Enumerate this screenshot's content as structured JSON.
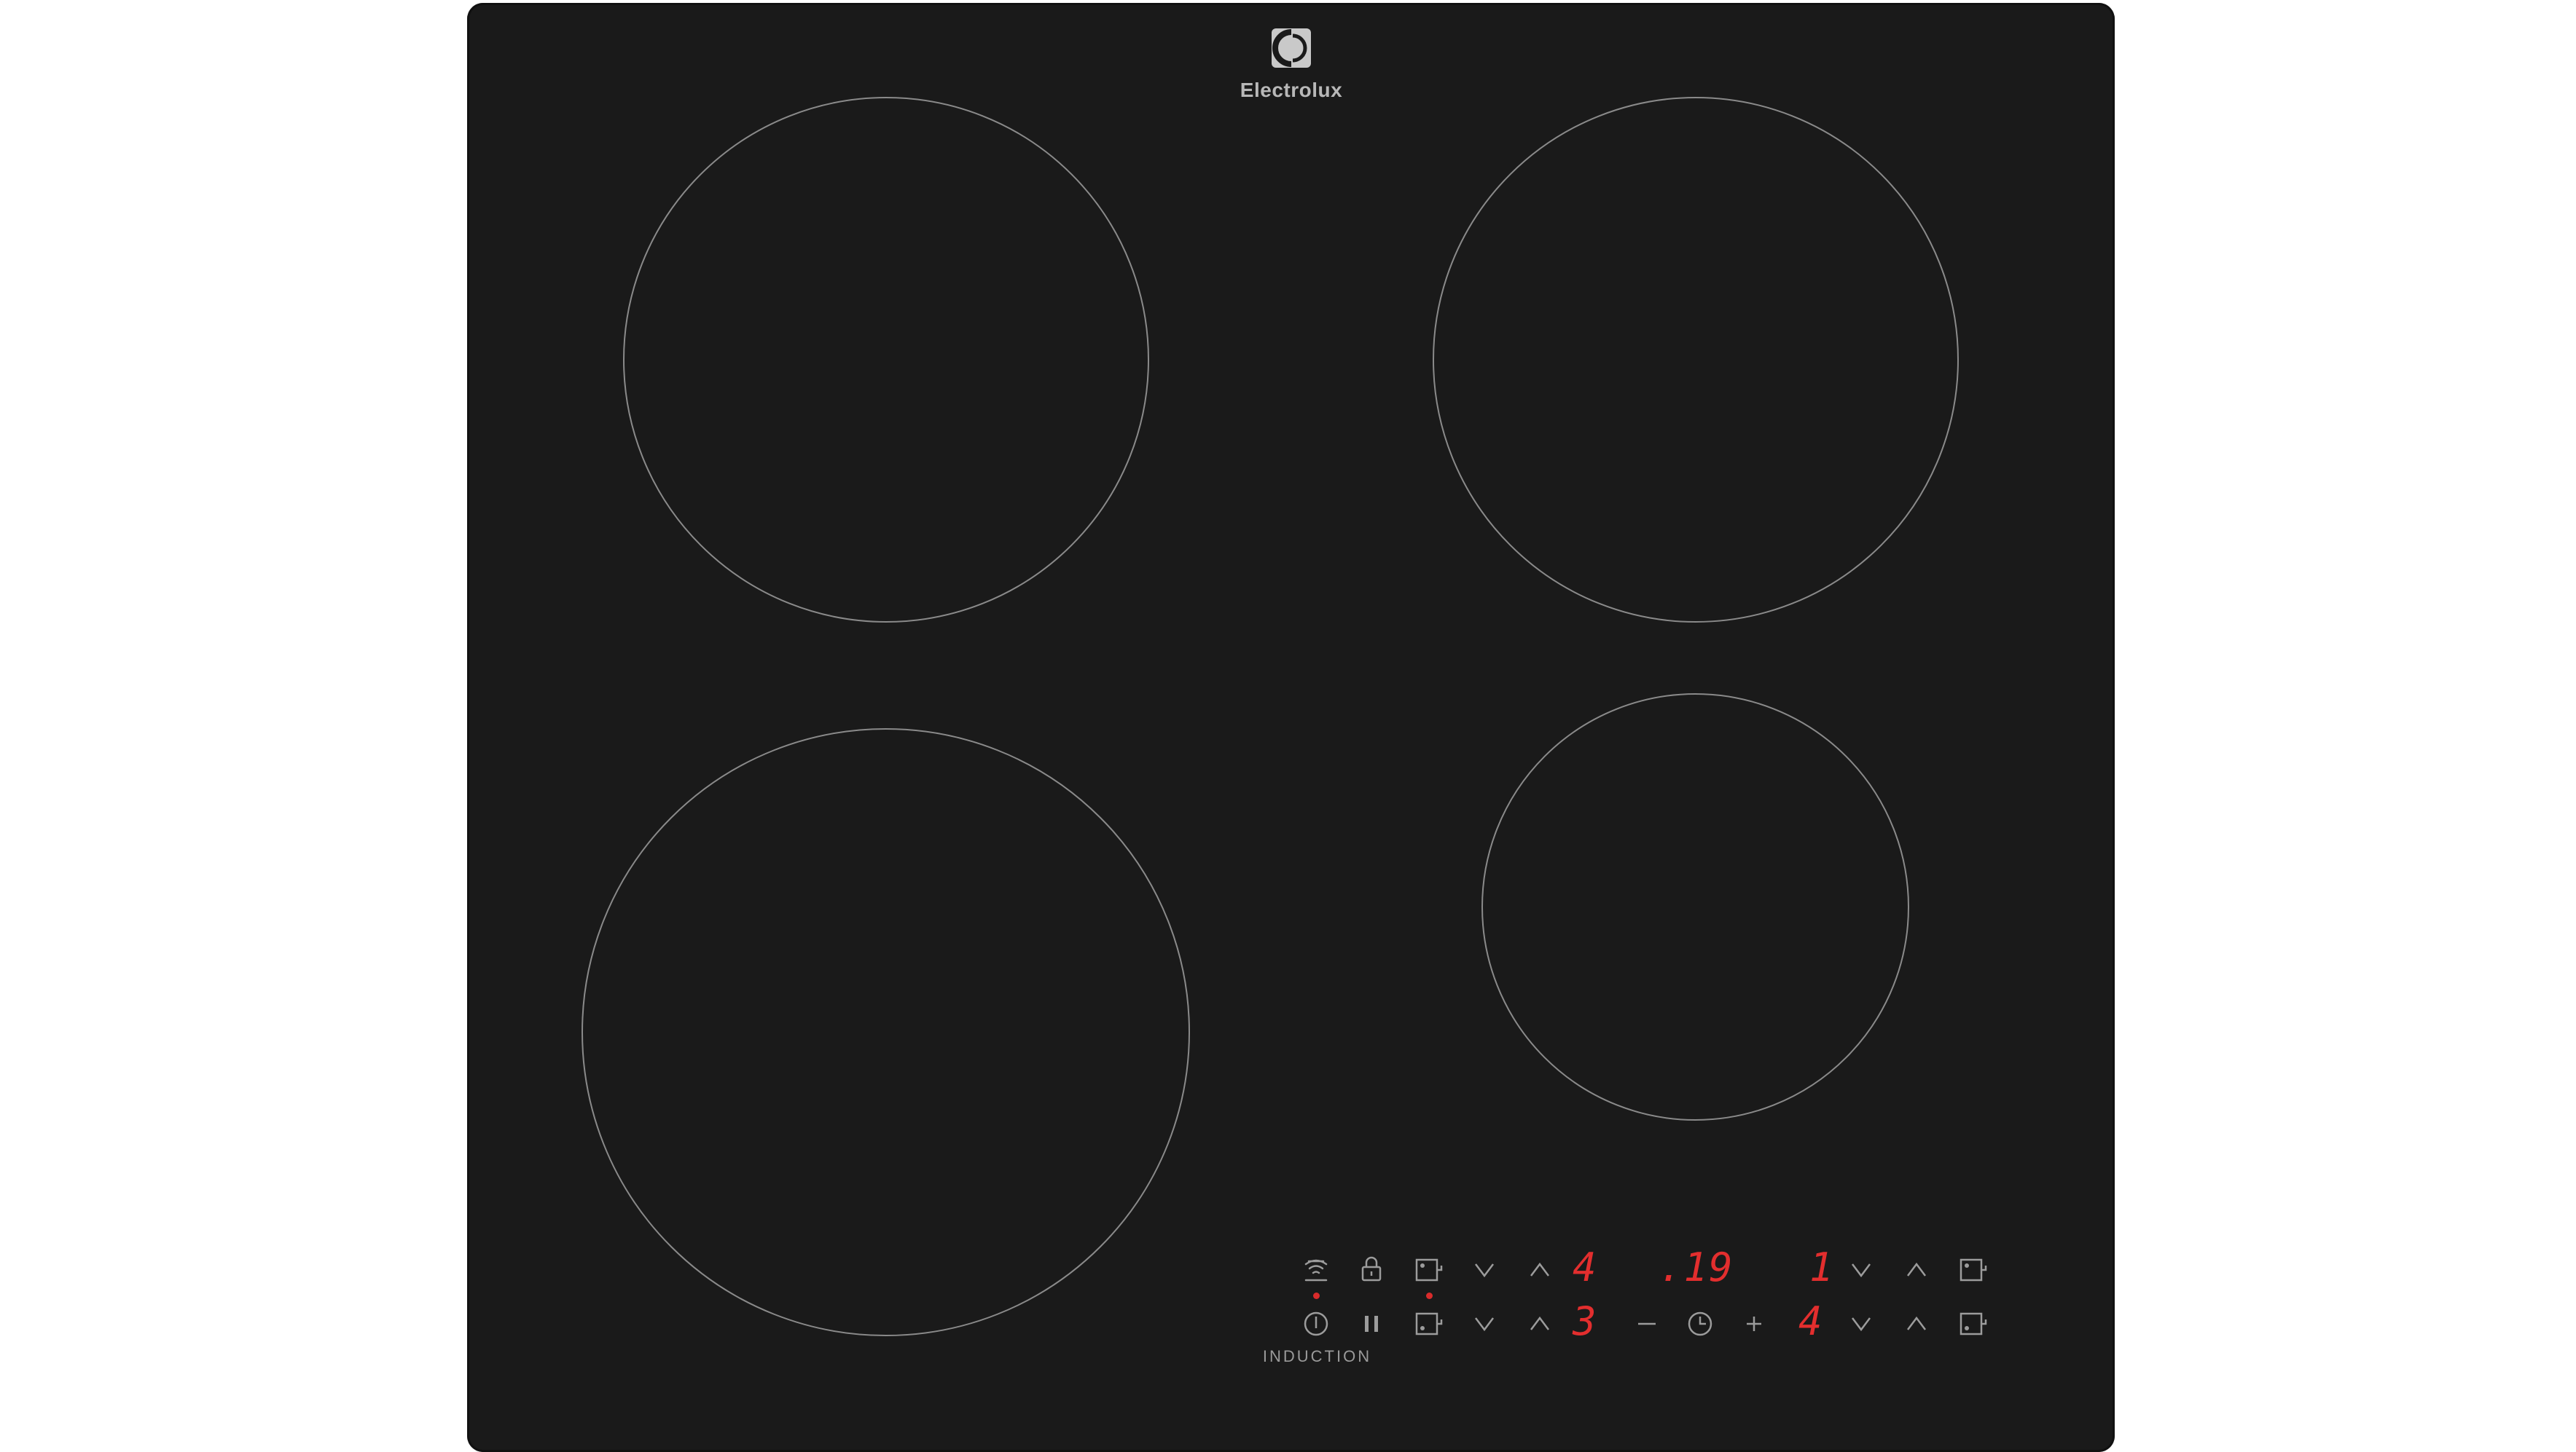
{
  "brand": {
    "name": "Electrolux"
  },
  "panel": {
    "label": "INDUCTION"
  },
  "displays": {
    "rear_left_power": "4",
    "timer": ".19",
    "rear_right_power": "1",
    "front_left_power": "3",
    "front_right_power": "4"
  },
  "icons": {
    "wifi": "hob-to-hood-wifi-icon",
    "lock": "lock-icon",
    "bridge": "bridge-zone-icon",
    "down": "chevron-down-icon",
    "up": "chevron-up-icon",
    "power": "power-icon",
    "pause": "pause-icon",
    "minus": "minus-icon",
    "timer": "timer-icon",
    "plus": "plus-icon"
  },
  "colors": {
    "glass": "#1a1a1a",
    "display_red": "#e32e2e",
    "zone_outline": "#8a8a8a",
    "symbol": "#9c9c9c"
  }
}
